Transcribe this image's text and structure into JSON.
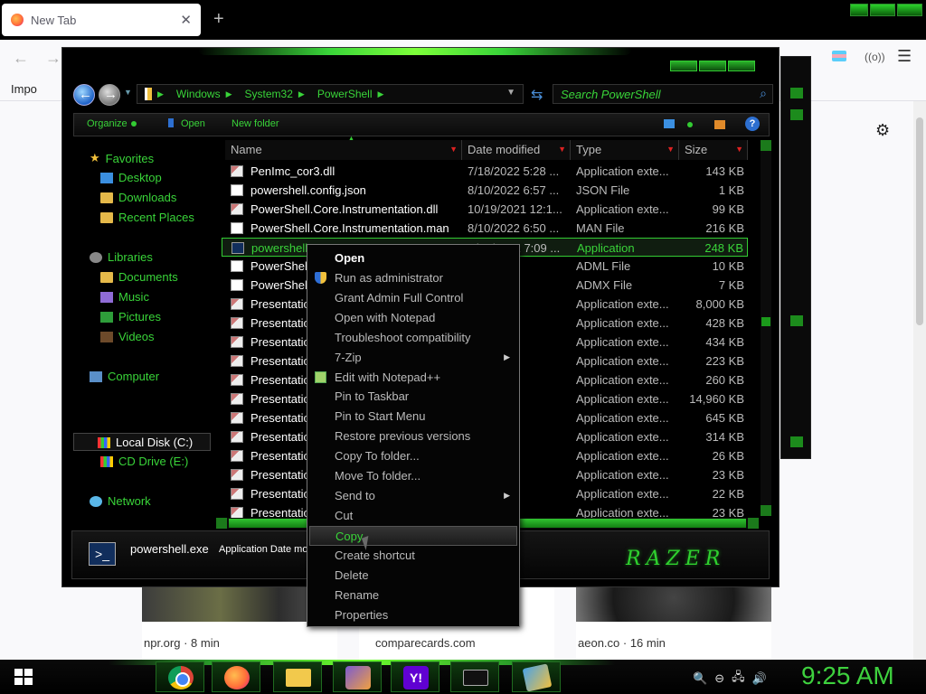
{
  "browser": {
    "tab_title": "New Tab",
    "tab_close": "✕",
    "new_tab": "+",
    "bookmark_import": "Impo",
    "nav_back": "←",
    "nav_forward": "→",
    "nav_menu": "☰",
    "nav_extension": "((o))",
    "settings_icon": "⚙",
    "cards": [
      {
        "source": "npr.org · 8 min"
      },
      {
        "source": "comparecards.com"
      },
      {
        "source": "aeon.co · 16 min"
      }
    ]
  },
  "explorer": {
    "breadcrumb": [
      "Windows",
      "System32",
      "PowerShell"
    ],
    "breadcrumb_sep": "▶",
    "address_dropdown": "▼",
    "refresh_icon": "⇆",
    "search_placeholder": "Search PowerShell",
    "search_icon": "⌕",
    "toolbar": {
      "organize": "Organize",
      "open": "Open",
      "new_folder": "New folder",
      "help": "?"
    },
    "nav_pane": {
      "favorites": "Favorites",
      "desktop": "Desktop",
      "downloads": "Downloads",
      "recent_places": "Recent Places",
      "libraries": "Libraries",
      "documents": "Documents",
      "music": "Music",
      "pictures": "Pictures",
      "videos": "Videos",
      "computer": "Computer",
      "local_disk": "Local Disk (C:)",
      "cd_drive": "CD Drive (E:)",
      "network": "Network"
    },
    "columns": {
      "name": "Name",
      "date": "Date modified",
      "type": "Type",
      "size": "Size",
      "sort_arrow": "▼",
      "sort_indicator": "▲"
    },
    "files": [
      {
        "name": "PenImc_cor3.dll",
        "date": "7/18/2022 5:28 ...",
        "type": "Application exte...",
        "size": "143 KB",
        "icon": "dll"
      },
      {
        "name": "powershell.config.json",
        "date": "8/10/2022 6:57 ...",
        "type": "JSON File",
        "size": "1 KB",
        "icon": "doc"
      },
      {
        "name": "PowerShell.Core.Instrumentation.dll",
        "date": "10/19/2021 12:1...",
        "type": "Application exte...",
        "size": "99 KB",
        "icon": "dll"
      },
      {
        "name": "PowerShell.Core.Instrumentation.man",
        "date": "8/10/2022 6:50 ...",
        "type": "MAN File",
        "size": "216 KB",
        "icon": "doc"
      },
      {
        "name": "powershell.exe",
        "date": "8/10/2022 7:09 ...",
        "type": "Application",
        "size": "248 KB",
        "icon": "exe",
        "selected": true
      },
      {
        "name": "PowerShell.exe.adml",
        "date": "6:50 ...",
        "type": "ADML File",
        "size": "10 KB",
        "icon": "doc"
      },
      {
        "name": "PowerShell.exe.admx",
        "date": "6:50 ...",
        "type": "ADMX File",
        "size": "7 KB",
        "icon": "doc"
      },
      {
        "name": "PresentationCore.dll",
        "date": "7:01 ...",
        "type": "Application exte...",
        "size": "8,000 KB",
        "icon": "dll"
      },
      {
        "name": "PresentationFramework.Aero.dll",
        "date": "7:01 ...",
        "type": "Application exte...",
        "size": "428 KB",
        "icon": "dll"
      },
      {
        "name": "PresentationFramework.Aero2.dll",
        "date": "7:01 ...",
        "type": "Application exte...",
        "size": "434 KB",
        "icon": "dll"
      },
      {
        "name": "PresentationFramework.AeroLite.dll",
        "date": "7:01 ...",
        "type": "Application exte...",
        "size": "223 KB",
        "icon": "dll"
      },
      {
        "name": "PresentationFramework.Classic.dll",
        "date": "7:01 ...",
        "type": "Application exte...",
        "size": "260 KB",
        "icon": "dll"
      },
      {
        "name": "PresentationFramework.dll",
        "date": "7:01 ...",
        "type": "Application exte...",
        "size": "14,960 KB",
        "icon": "dll"
      },
      {
        "name": "PresentationFramework.Luna.dll",
        "date": "7:01 ...",
        "type": "Application exte...",
        "size": "645 KB",
        "icon": "dll"
      },
      {
        "name": "PresentationFramework.Royale.dll",
        "date": "7:01 ...",
        "type": "Application exte...",
        "size": "314 KB",
        "icon": "dll"
      },
      {
        "name": "PresentationFramework-SystemCore.dll",
        "date": "7:01 ...",
        "type": "Application exte...",
        "size": "26 KB",
        "icon": "dll"
      },
      {
        "name": "PresentationFramework-SystemData.dll",
        "date": "7:01 ...",
        "type": "Application exte...",
        "size": "23 KB",
        "icon": "dll"
      },
      {
        "name": "PresentationFramework-SystemDrawing.dll",
        "date": "7:01 ...",
        "type": "Application exte...",
        "size": "22 KB",
        "icon": "dll"
      },
      {
        "name": "PresentationFramework-SystemXml.dll",
        "date": "7:01 ...",
        "type": "Application exte...",
        "size": "23 KB",
        "icon": "dll"
      }
    ],
    "details": {
      "filename": "powershell.exe",
      "meta": "Application Date mod",
      "logo": "RAZER",
      "icon_glyph": "&gt;_"
    }
  },
  "context_menu": {
    "items": [
      {
        "label": "Open",
        "bold": true
      },
      {
        "label": "Run as administrator",
        "icon": "shield"
      },
      {
        "label": "Grant Admin Full Control"
      },
      {
        "label": "Open with Notepad"
      },
      {
        "label": "Troubleshoot compatibility"
      },
      {
        "label": "7-Zip",
        "submenu": true
      },
      {
        "label": "Edit with Notepad++",
        "icon": "npp"
      },
      {
        "label": "Pin to Taskbar"
      },
      {
        "label": "Pin to Start Menu"
      },
      {
        "label": "Restore previous versions"
      },
      {
        "label": "Copy To folder..."
      },
      {
        "label": "Move To folder..."
      },
      {
        "label": "Send to",
        "submenu": true
      },
      {
        "label": "Cut"
      },
      {
        "label": "Copy",
        "highlighted": true
      },
      {
        "label": "Create shortcut"
      },
      {
        "label": "Delete"
      },
      {
        "label": "Rename"
      },
      {
        "label": "Properties"
      }
    ],
    "submenu_arrow": "▶"
  },
  "taskbar": {
    "yahoo_letter": "Y!",
    "tray_icons": [
      "🔍",
      "⊖",
      "🖧",
      "🔊"
    ],
    "clock": "9:25 AM"
  }
}
